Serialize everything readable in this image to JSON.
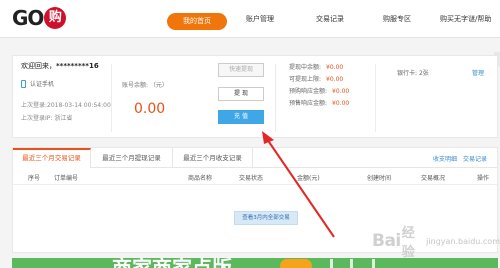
{
  "app": {
    "logo_text": "GO",
    "logo_badge": "购"
  },
  "nav": {
    "active": "我的首页",
    "items": [
      "账户管理",
      "交易记录",
      "购服专区",
      "购买无字谜/帮助"
    ]
  },
  "account": {
    "greeting": "欢迎回来，",
    "username": "*********16",
    "phone_label": "认证手机",
    "last_login_label": "上次登录:",
    "last_login_time": "2018-03-14 00:54:00",
    "last_login_ip_label": "上次登录IP:",
    "last_login_ip": "浙江省",
    "balance_label": "账号余额: （元）",
    "balance_value": "0.00",
    "buttons": {
      "express": "快速提现",
      "withdraw": "提 现",
      "recharge": "充 值"
    },
    "stats": [
      {
        "label": "提现中余额:",
        "value": "¥0.00"
      },
      {
        "label": "可提现上限:",
        "value": "¥0.00"
      },
      {
        "label": "预购响应金额:",
        "value": "¥0.00"
      },
      {
        "label": "预售响应金额:",
        "value": "¥0.00"
      }
    ],
    "bank_label": "银行卡:",
    "bank_count": "2张",
    "bank_manage": "管理"
  },
  "records": {
    "tabs": [
      "最近三个月交易记录",
      "最近三个月提现记录",
      "最近三个月收支记录"
    ],
    "links": [
      "收支明细",
      "交易记录"
    ],
    "columns": [
      "序号",
      "订单编号",
      "商品名称",
      "交易状态",
      "金额(元)",
      "创建时间",
      "交易概况",
      "操作"
    ],
    "view_all": "查看3月内全部交易"
  },
  "banner": {
    "text": "商家商家点版"
  },
  "watermark": {
    "brand": "Bai",
    "brand2": "经验",
    "sub": "jingyan.baidu.com"
  },
  "colors": {
    "accent_orange": "#f0760c",
    "accent_blue": "#3fa7e6",
    "amount_red": "#e8511a",
    "annotation_red": "#e32727"
  }
}
